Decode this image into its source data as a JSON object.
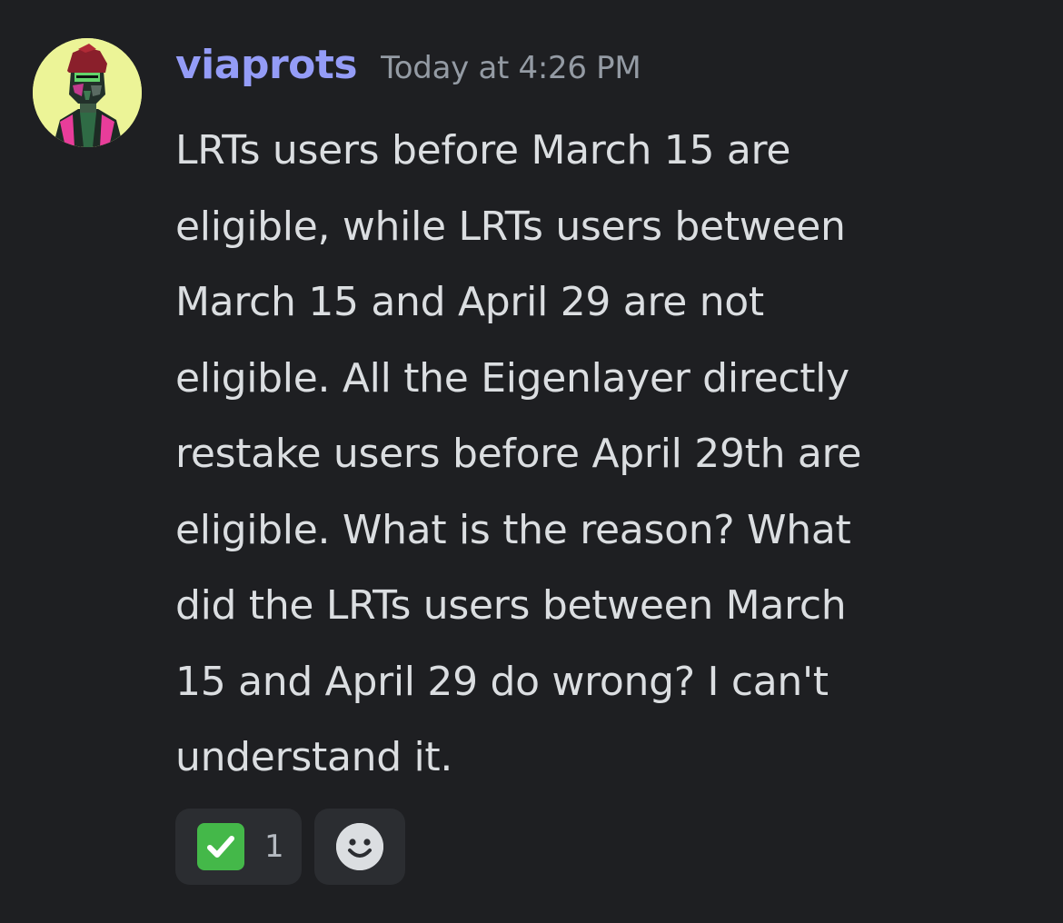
{
  "message": {
    "author": "viaprots",
    "timestamp": "Today at 4:26 PM",
    "content": "LRTs users before March 15 are\neligible, while LRTs users between\nMarch 15 and April 29 are not\neligible. All the Eigenlayer directly\nrestake users before April 29th are\neligible. What is the reason? What\ndid the LRTs users between March\n15 and April 29 do wrong? I can't\nunderstand it.",
    "avatar_icon": "user-avatar-art"
  },
  "reactions": [
    {
      "emoji": "white-check-mark",
      "count": "1"
    }
  ],
  "add_reaction_icon": "smiley-face-icon",
  "colors": {
    "background": "#1e1f22",
    "username": "#949cf7",
    "timestamp": "#949ba4",
    "text": "#dbdee1",
    "reaction_bg": "#2b2d31",
    "check_green": "#44b849",
    "avatar_bg": "#ecf497"
  }
}
